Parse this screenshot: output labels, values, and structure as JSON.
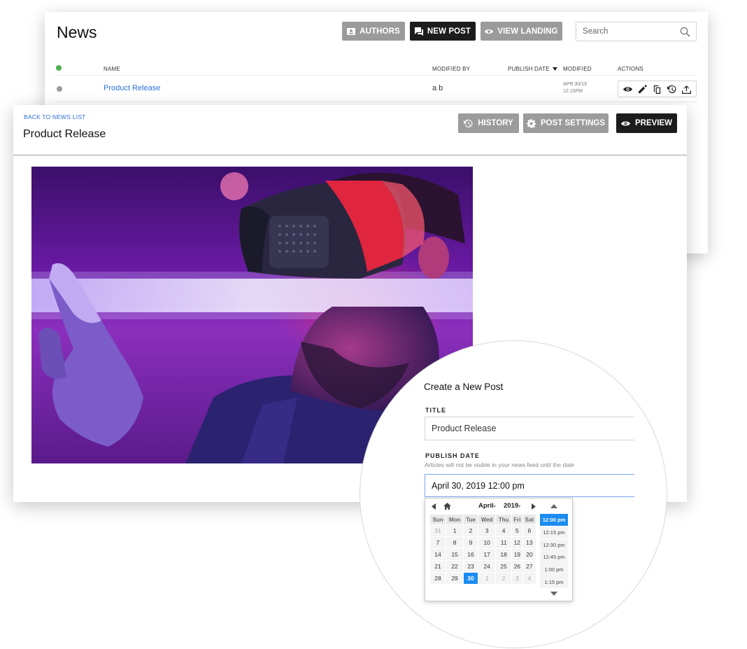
{
  "news": {
    "title": "News",
    "buttons": {
      "authors": "AUTHORS",
      "new_post": "NEW POST",
      "view_landing": "VIEW LANDING"
    },
    "search_placeholder": "Search",
    "columns": {
      "name": "NAME",
      "modified_by": "MODIFIED BY",
      "publish_date": "PUBLISH DATE",
      "modified": "MODIFIED",
      "actions": "ACTIONS"
    },
    "rows": [
      {
        "name": "Product Release",
        "modified_by": "a b",
        "modified_date": "APR 30/19",
        "modified_time": "12:15PM"
      }
    ]
  },
  "editor": {
    "back_link": "BACK TO NEWS LIST",
    "title": "Product Release",
    "buttons": {
      "history": "HISTORY",
      "post_settings": "POST SETTINGS",
      "preview": "PREVIEW"
    }
  },
  "create_post": {
    "heading": "Create a New Post",
    "title_label": "TITLE",
    "title_value": "Product Release",
    "publish_label": "PUBLISH DATE",
    "publish_hint": "Articles will not be visible in your news feed until the date",
    "publish_value": "April 30, 2019 12:00 pm",
    "picker": {
      "month": "April",
      "year": "2019",
      "weekdays": [
        "Sun",
        "Mon",
        "Tue",
        "Wed",
        "Thu",
        "Fri",
        "Sat"
      ],
      "weeks": [
        [
          "31",
          "1",
          "2",
          "3",
          "4",
          "5",
          "6"
        ],
        [
          "7",
          "8",
          "9",
          "10",
          "11",
          "12",
          "13"
        ],
        [
          "14",
          "15",
          "16",
          "17",
          "18",
          "19",
          "20"
        ],
        [
          "21",
          "22",
          "23",
          "24",
          "25",
          "26",
          "27"
        ],
        [
          "28",
          "29",
          "30",
          "1",
          "2",
          "3",
          "4"
        ]
      ],
      "selected_day": "30",
      "times": [
        "12:00 pm",
        "12:15 pm",
        "12:30 pm",
        "12:45 pm",
        "1:00 pm",
        "1:15 pm"
      ],
      "selected_time": "12:00 pm"
    }
  },
  "colors": {
    "link": "#2b6fd6",
    "accent": "#1c8cf0",
    "dark_button": "#1c1c1c",
    "gray_button": "#9b9b9b",
    "status_active": "#4caf50"
  }
}
